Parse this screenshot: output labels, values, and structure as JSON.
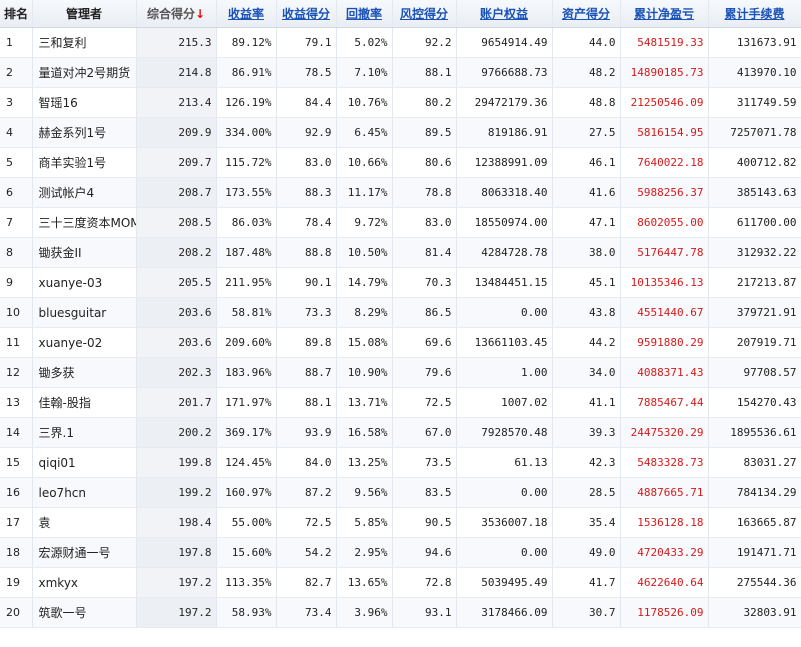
{
  "headers": {
    "rank": "排名",
    "manager": "管理者",
    "total_score": "综合得分",
    "sort_arrow": "↓",
    "return_rate": "收益率",
    "return_score": "收益得分",
    "drawdown": "回撤率",
    "risk_score": "风控得分",
    "equity": "账户权益",
    "asset_score": "资产得分",
    "net_pnl": "累计净盈亏",
    "fees": "累计手续费"
  },
  "accent_colors": {
    "link": "#1a52b8",
    "negative": "#d21b1b",
    "sort_arrow": "#dd1111"
  },
  "rows": [
    {
      "rank": "1",
      "manager": "三和复利",
      "total": "215.3",
      "rate": "89.12%",
      "rscore": "79.1",
      "dd": "5.02%",
      "risk": "92.2",
      "equity": "9654914.49",
      "asset": "44.0",
      "pnl": "5481519.33",
      "fee": "131673.91"
    },
    {
      "rank": "2",
      "manager": "量道对冲2号期货",
      "total": "214.8",
      "rate": "86.91%",
      "rscore": "78.5",
      "dd": "7.10%",
      "risk": "88.1",
      "equity": "9766688.73",
      "asset": "48.2",
      "pnl": "14890185.73",
      "fee": "413970.10"
    },
    {
      "rank": "3",
      "manager": "智瑶16",
      "total": "213.4",
      "rate": "126.19%",
      "rscore": "84.4",
      "dd": "10.76%",
      "risk": "80.2",
      "equity": "29472179.36",
      "asset": "48.8",
      "pnl": "21250546.09",
      "fee": "311749.59"
    },
    {
      "rank": "4",
      "manager": "赫金系列1号",
      "total": "209.9",
      "rate": "334.00%",
      "rscore": "92.9",
      "dd": "6.45%",
      "risk": "89.5",
      "equity": "819186.91",
      "asset": "27.5",
      "pnl": "5816154.95",
      "fee": "7257071.78"
    },
    {
      "rank": "5",
      "manager": "商羊实验1号",
      "total": "209.7",
      "rate": "115.72%",
      "rscore": "83.0",
      "dd": "10.66%",
      "risk": "80.6",
      "equity": "12388991.09",
      "asset": "46.1",
      "pnl": "7640022.18",
      "fee": "400712.82"
    },
    {
      "rank": "6",
      "manager": "测试帐户4",
      "total": "208.7",
      "rate": "173.55%",
      "rscore": "88.3",
      "dd": "11.17%",
      "risk": "78.8",
      "equity": "8063318.40",
      "asset": "41.6",
      "pnl": "5988256.37",
      "fee": "385143.63"
    },
    {
      "rank": "7",
      "manager": "三十三度资本MOM",
      "total": "208.5",
      "rate": "86.03%",
      "rscore": "78.4",
      "dd": "9.72%",
      "risk": "83.0",
      "equity": "18550974.00",
      "asset": "47.1",
      "pnl": "8602055.00",
      "fee": "611700.00"
    },
    {
      "rank": "8",
      "manager": "锄获金II",
      "total": "208.2",
      "rate": "187.48%",
      "rscore": "88.8",
      "dd": "10.50%",
      "risk": "81.4",
      "equity": "4284728.78",
      "asset": "38.0",
      "pnl": "5176447.78",
      "fee": "312932.22"
    },
    {
      "rank": "9",
      "manager": "xuanye-03",
      "total": "205.5",
      "rate": "211.95%",
      "rscore": "90.1",
      "dd": "14.79%",
      "risk": "70.3",
      "equity": "13484451.15",
      "asset": "45.1",
      "pnl": "10135346.13",
      "fee": "217213.87"
    },
    {
      "rank": "10",
      "manager": "bluesguitar",
      "total": "203.6",
      "rate": "58.81%",
      "rscore": "73.3",
      "dd": "8.29%",
      "risk": "86.5",
      "equity": "0.00",
      "asset": "43.8",
      "pnl": "4551440.67",
      "fee": "379721.91"
    },
    {
      "rank": "11",
      "manager": "xuanye-02",
      "total": "203.6",
      "rate": "209.60%",
      "rscore": "89.8",
      "dd": "15.08%",
      "risk": "69.6",
      "equity": "13661103.45",
      "asset": "44.2",
      "pnl": "9591880.29",
      "fee": "207919.71"
    },
    {
      "rank": "12",
      "manager": "锄多获",
      "total": "202.3",
      "rate": "183.96%",
      "rscore": "88.7",
      "dd": "10.90%",
      "risk": "79.6",
      "equity": "1.00",
      "asset": "34.0",
      "pnl": "4088371.43",
      "fee": "97708.57"
    },
    {
      "rank": "13",
      "manager": "佳翰-股指",
      "total": "201.7",
      "rate": "171.97%",
      "rscore": "88.1",
      "dd": "13.71%",
      "risk": "72.5",
      "equity": "1007.02",
      "asset": "41.1",
      "pnl": "7885467.44",
      "fee": "154270.43"
    },
    {
      "rank": "14",
      "manager": "三界.1",
      "total": "200.2",
      "rate": "369.17%",
      "rscore": "93.9",
      "dd": "16.58%",
      "risk": "67.0",
      "equity": "7928570.48",
      "asset": "39.3",
      "pnl": "24475320.29",
      "fee": "1895536.61"
    },
    {
      "rank": "15",
      "manager": "qiqi01",
      "total": "199.8",
      "rate": "124.45%",
      "rscore": "84.0",
      "dd": "13.25%",
      "risk": "73.5",
      "equity": "61.13",
      "asset": "42.3",
      "pnl": "5483328.73",
      "fee": "83031.27"
    },
    {
      "rank": "16",
      "manager": "leo7hcn",
      "total": "199.2",
      "rate": "160.97%",
      "rscore": "87.2",
      "dd": "9.56%",
      "risk": "83.5",
      "equity": "0.00",
      "asset": "28.5",
      "pnl": "4887665.71",
      "fee": "784134.29"
    },
    {
      "rank": "17",
      "manager": "袁",
      "total": "198.4",
      "rate": "55.00%",
      "rscore": "72.5",
      "dd": "5.85%",
      "risk": "90.5",
      "equity": "3536007.18",
      "asset": "35.4",
      "pnl": "1536128.18",
      "fee": "163665.87"
    },
    {
      "rank": "18",
      "manager": "宏源财通一号",
      "total": "197.8",
      "rate": "15.60%",
      "rscore": "54.2",
      "dd": "2.95%",
      "risk": "94.6",
      "equity": "0.00",
      "asset": "49.0",
      "pnl": "4720433.29",
      "fee": "191471.71"
    },
    {
      "rank": "19",
      "manager": "xmkyx",
      "total": "197.2",
      "rate": "113.35%",
      "rscore": "82.7",
      "dd": "13.65%",
      "risk": "72.8",
      "equity": "5039495.49",
      "asset": "41.7",
      "pnl": "4622640.64",
      "fee": "275544.36"
    },
    {
      "rank": "20",
      "manager": "筑歌一号",
      "total": "197.2",
      "rate": "58.93%",
      "rscore": "73.4",
      "dd": "3.96%",
      "risk": "93.1",
      "equity": "3178466.09",
      "asset": "30.7",
      "pnl": "1178526.09",
      "fee": "32803.91"
    }
  ]
}
